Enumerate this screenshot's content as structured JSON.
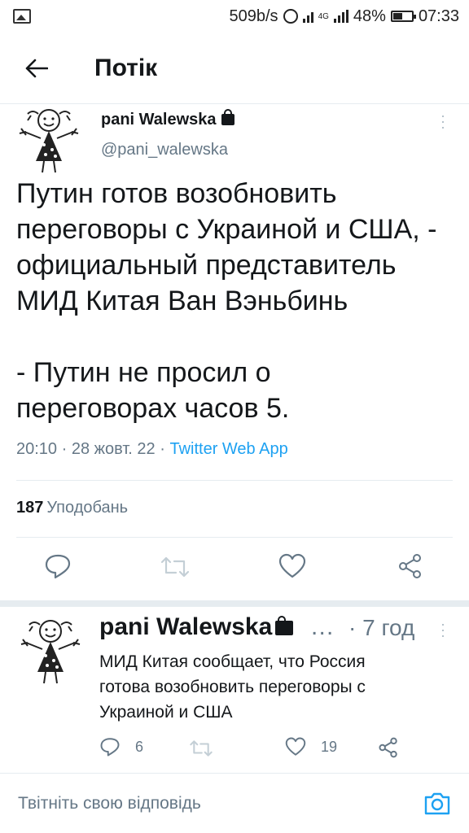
{
  "status_bar": {
    "net_speed": "509b/s",
    "network_type": "4G",
    "battery": "48%",
    "time": "07:33"
  },
  "header": {
    "title": "Потік"
  },
  "main_tweet": {
    "name": "pani Walewska",
    "handle": "@pani_walewska",
    "text_lines": [
      "Путин готов возобновить",
      "переговоры с Украиной и США, -",
      "официальный представитель",
      "МИД Китая Ван Вэньбинь",
      "",
      "- Путин не просил о",
      "переговорах часов 5."
    ],
    "time": "20:10",
    "date": "28 жовт. 22",
    "separator": "·",
    "source": "Twitter Web App",
    "likes_count": "187",
    "likes_label": "Уподобань"
  },
  "reply_tweet": {
    "name": "pani Walewska",
    "ellipsis": "…",
    "age": "· 7 год",
    "text_lines": [
      "МИД Китая сообщает, что Россия",
      "готова возобновить переговоры с",
      "Украиной и США"
    ],
    "reply_count": "6",
    "like_count": "19"
  },
  "reply_bar": {
    "placeholder": "Твітніть свою відповідь"
  },
  "colors": {
    "accent": "#1da1f2",
    "muted": "#657786",
    "text": "#14171a",
    "divider": "#e6ecf0"
  }
}
